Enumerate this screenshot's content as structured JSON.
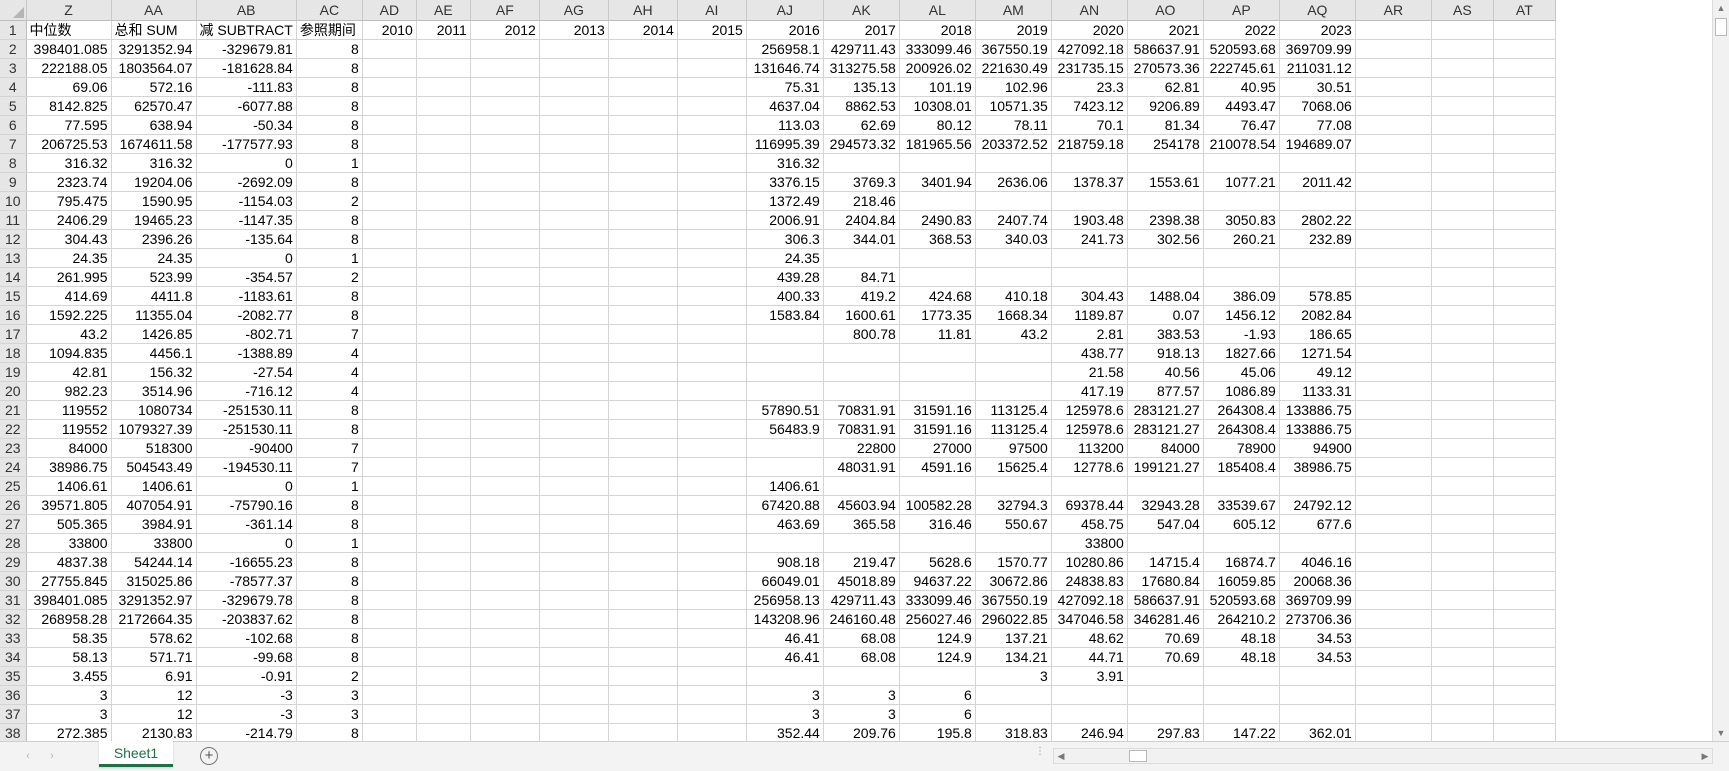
{
  "columns": [
    {
      "name": "Z",
      "header": "中位数"
    },
    {
      "name": "AA",
      "header": "总和 SUM"
    },
    {
      "name": "AB",
      "header": "减 SUBTRACT"
    },
    {
      "name": "AC",
      "header": "参照期间"
    },
    {
      "name": "AD",
      "header": "2010"
    },
    {
      "name": "AE",
      "header": "2011"
    },
    {
      "name": "AF",
      "header": "2012"
    },
    {
      "name": "AG",
      "header": "2013"
    },
    {
      "name": "AH",
      "header": "2014"
    },
    {
      "name": "AI",
      "header": "2015"
    },
    {
      "name": "AJ",
      "header": "2016"
    },
    {
      "name": "AK",
      "header": "2017"
    },
    {
      "name": "AL",
      "header": "2018"
    },
    {
      "name": "AM",
      "header": "2019"
    },
    {
      "name": "AN",
      "header": "2020"
    },
    {
      "name": "AO",
      "header": "2021"
    },
    {
      "name": "AP",
      "header": "2022"
    },
    {
      "name": "AQ",
      "header": "2023"
    },
    {
      "name": "AR",
      "header": ""
    },
    {
      "name": "AS",
      "header": ""
    },
    {
      "name": "AT",
      "header": ""
    }
  ],
  "rows": [
    {
      "n": "2",
      "z": "398401.085",
      "aa": "3291352.94",
      "ab": "-329679.81",
      "ac": "8",
      "y2016": "256958.1",
      "y2017": "429711.43",
      "y2018": "333099.46",
      "y2019": "367550.19",
      "y2020": "427092.18",
      "y2021": "586637.91",
      "y2022": "520593.68",
      "y2023": "369709.99"
    },
    {
      "n": "3",
      "z": "222188.05",
      "aa": "1803564.07",
      "ab": "-181628.84",
      "ac": "8",
      "y2016": "131646.74",
      "y2017": "313275.58",
      "y2018": "200926.02",
      "y2019": "221630.49",
      "y2020": "231735.15",
      "y2021": "270573.36",
      "y2022": "222745.61",
      "y2023": "211031.12"
    },
    {
      "n": "4",
      "z": "69.06",
      "aa": "572.16",
      "ab": "-111.83",
      "ac": "8",
      "y2016": "75.31",
      "y2017": "135.13",
      "y2018": "101.19",
      "y2019": "102.96",
      "y2020": "23.3",
      "y2021": "62.81",
      "y2022": "40.95",
      "y2023": "30.51"
    },
    {
      "n": "5",
      "z": "8142.825",
      "aa": "62570.47",
      "ab": "-6077.88",
      "ac": "8",
      "y2016": "4637.04",
      "y2017": "8862.53",
      "y2018": "10308.01",
      "y2019": "10571.35",
      "y2020": "7423.12",
      "y2021": "9206.89",
      "y2022": "4493.47",
      "y2023": "7068.06"
    },
    {
      "n": "6",
      "z": "77.595",
      "aa": "638.94",
      "ab": "-50.34",
      "ac": "8",
      "y2016": "113.03",
      "y2017": "62.69",
      "y2018": "80.12",
      "y2019": "78.11",
      "y2020": "70.1",
      "y2021": "81.34",
      "y2022": "76.47",
      "y2023": "77.08"
    },
    {
      "n": "7",
      "z": "206725.53",
      "aa": "1674611.58",
      "ab": "-177577.93",
      "ac": "8",
      "y2016": "116995.39",
      "y2017": "294573.32",
      "y2018": "181965.56",
      "y2019": "203372.52",
      "y2020": "218759.18",
      "y2021": "254178",
      "y2022": "210078.54",
      "y2023": "194689.07"
    },
    {
      "n": "8",
      "z": "316.32",
      "aa": "316.32",
      "ab": "0",
      "ac": "1",
      "y2016": "316.32",
      "y2017": "",
      "y2018": "",
      "y2019": "",
      "y2020": "",
      "y2021": "",
      "y2022": "",
      "y2023": ""
    },
    {
      "n": "9",
      "z": "2323.74",
      "aa": "19204.06",
      "ab": "-2692.09",
      "ac": "8",
      "y2016": "3376.15",
      "y2017": "3769.3",
      "y2018": "3401.94",
      "y2019": "2636.06",
      "y2020": "1378.37",
      "y2021": "1553.61",
      "y2022": "1077.21",
      "y2023": "2011.42"
    },
    {
      "n": "10",
      "z": "795.475",
      "aa": "1590.95",
      "ab": "-1154.03",
      "ac": "2",
      "y2016": "1372.49",
      "y2017": "218.46",
      "y2018": "",
      "y2019": "",
      "y2020": "",
      "y2021": "",
      "y2022": "",
      "y2023": ""
    },
    {
      "n": "11",
      "z": "2406.29",
      "aa": "19465.23",
      "ab": "-1147.35",
      "ac": "8",
      "y2016": "2006.91",
      "y2017": "2404.84",
      "y2018": "2490.83",
      "y2019": "2407.74",
      "y2020": "1903.48",
      "y2021": "2398.38",
      "y2022": "3050.83",
      "y2023": "2802.22"
    },
    {
      "n": "12",
      "z": "304.43",
      "aa": "2396.26",
      "ab": "-135.64",
      "ac": "8",
      "y2016": "306.3",
      "y2017": "344.01",
      "y2018": "368.53",
      "y2019": "340.03",
      "y2020": "241.73",
      "y2021": "302.56",
      "y2022": "260.21",
      "y2023": "232.89"
    },
    {
      "n": "13",
      "z": "24.35",
      "aa": "24.35",
      "ab": "0",
      "ac": "1",
      "y2016": "24.35",
      "y2017": "",
      "y2018": "",
      "y2019": "",
      "y2020": "",
      "y2021": "",
      "y2022": "",
      "y2023": ""
    },
    {
      "n": "14",
      "z": "261.995",
      "aa": "523.99",
      "ab": "-354.57",
      "ac": "2",
      "y2016": "439.28",
      "y2017": "84.71",
      "y2018": "",
      "y2019": "",
      "y2020": "",
      "y2021": "",
      "y2022": "",
      "y2023": ""
    },
    {
      "n": "15",
      "z": "414.69",
      "aa": "4411.8",
      "ab": "-1183.61",
      "ac": "8",
      "y2016": "400.33",
      "y2017": "419.2",
      "y2018": "424.68",
      "y2019": "410.18",
      "y2020": "304.43",
      "y2021": "1488.04",
      "y2022": "386.09",
      "y2023": "578.85"
    },
    {
      "n": "16",
      "z": "1592.225",
      "aa": "11355.04",
      "ab": "-2082.77",
      "ac": "8",
      "y2016": "1583.84",
      "y2017": "1600.61",
      "y2018": "1773.35",
      "y2019": "1668.34",
      "y2020": "1189.87",
      "y2021": "0.07",
      "y2022": "1456.12",
      "y2023": "2082.84"
    },
    {
      "n": "17",
      "z": "43.2",
      "aa": "1426.85",
      "ab": "-802.71",
      "ac": "7",
      "y2016": "",
      "y2017": "800.78",
      "y2018": "11.81",
      "y2019": "43.2",
      "y2020": "2.81",
      "y2021": "383.53",
      "y2022": "-1.93",
      "y2023": "186.65"
    },
    {
      "n": "18",
      "z": "1094.835",
      "aa": "4456.1",
      "ab": "-1388.89",
      "ac": "4",
      "y2016": "",
      "y2017": "",
      "y2018": "",
      "y2019": "",
      "y2020": "438.77",
      "y2021": "918.13",
      "y2022": "1827.66",
      "y2023": "1271.54"
    },
    {
      "n": "19",
      "z": "42.81",
      "aa": "156.32",
      "ab": "-27.54",
      "ac": "4",
      "y2016": "",
      "y2017": "",
      "y2018": "",
      "y2019": "",
      "y2020": "21.58",
      "y2021": "40.56",
      "y2022": "45.06",
      "y2023": "49.12"
    },
    {
      "n": "20",
      "z": "982.23",
      "aa": "3514.96",
      "ab": "-716.12",
      "ac": "4",
      "y2016": "",
      "y2017": "",
      "y2018": "",
      "y2019": "",
      "y2020": "417.19",
      "y2021": "877.57",
      "y2022": "1086.89",
      "y2023": "1133.31"
    },
    {
      "n": "21",
      "z": "119552",
      "aa": "1080734",
      "ab": "-251530.11",
      "ac": "8",
      "y2016": "57890.51",
      "y2017": "70831.91",
      "y2018": "31591.16",
      "y2019": "113125.4",
      "y2020": "125978.6",
      "y2021": "283121.27",
      "y2022": "264308.4",
      "y2023": "133886.75"
    },
    {
      "n": "22",
      "z": "119552",
      "aa": "1079327.39",
      "ab": "-251530.11",
      "ac": "8",
      "y2016": "56483.9",
      "y2017": "70831.91",
      "y2018": "31591.16",
      "y2019": "113125.4",
      "y2020": "125978.6",
      "y2021": "283121.27",
      "y2022": "264308.4",
      "y2023": "133886.75"
    },
    {
      "n": "23",
      "z": "84000",
      "aa": "518300",
      "ab": "-90400",
      "ac": "7",
      "y2016": "",
      "y2017": "22800",
      "y2018": "27000",
      "y2019": "97500",
      "y2020": "113200",
      "y2021": "84000",
      "y2022": "78900",
      "y2023": "94900"
    },
    {
      "n": "24",
      "z": "38986.75",
      "aa": "504543.49",
      "ab": "-194530.11",
      "ac": "7",
      "y2016": "",
      "y2017": "48031.91",
      "y2018": "4591.16",
      "y2019": "15625.4",
      "y2020": "12778.6",
      "y2021": "199121.27",
      "y2022": "185408.4",
      "y2023": "38986.75"
    },
    {
      "n": "25",
      "z": "1406.61",
      "aa": "1406.61",
      "ab": "0",
      "ac": "1",
      "y2016": "1406.61",
      "y2017": "",
      "y2018": "",
      "y2019": "",
      "y2020": "",
      "y2021": "",
      "y2022": "",
      "y2023": ""
    },
    {
      "n": "26",
      "z": "39571.805",
      "aa": "407054.91",
      "ab": "-75790.16",
      "ac": "8",
      "y2016": "67420.88",
      "y2017": "45603.94",
      "y2018": "100582.28",
      "y2019": "32794.3",
      "y2020": "69378.44",
      "y2021": "32943.28",
      "y2022": "33539.67",
      "y2023": "24792.12"
    },
    {
      "n": "27",
      "z": "505.365",
      "aa": "3984.91",
      "ab": "-361.14",
      "ac": "8",
      "y2016": "463.69",
      "y2017": "365.58",
      "y2018": "316.46",
      "y2019": "550.67",
      "y2020": "458.75",
      "y2021": "547.04",
      "y2022": "605.12",
      "y2023": "677.6"
    },
    {
      "n": "28",
      "z": "33800",
      "aa": "33800",
      "ab": "0",
      "ac": "1",
      "y2016": "",
      "y2017": "",
      "y2018": "",
      "y2019": "",
      "y2020": "33800",
      "y2021": "",
      "y2022": "",
      "y2023": ""
    },
    {
      "n": "29",
      "z": "4837.38",
      "aa": "54244.14",
      "ab": "-16655.23",
      "ac": "8",
      "y2016": "908.18",
      "y2017": "219.47",
      "y2018": "5628.6",
      "y2019": "1570.77",
      "y2020": "10280.86",
      "y2021": "14715.4",
      "y2022": "16874.7",
      "y2023": "4046.16"
    },
    {
      "n": "30",
      "z": "27755.845",
      "aa": "315025.86",
      "ab": "-78577.37",
      "ac": "8",
      "y2016": "66049.01",
      "y2017": "45018.89",
      "y2018": "94637.22",
      "y2019": "30672.86",
      "y2020": "24838.83",
      "y2021": "17680.84",
      "y2022": "16059.85",
      "y2023": "20068.36"
    },
    {
      "n": "31",
      "z": "398401.085",
      "aa": "3291352.97",
      "ab": "-329679.78",
      "ac": "8",
      "y2016": "256958.13",
      "y2017": "429711.43",
      "y2018": "333099.46",
      "y2019": "367550.19",
      "y2020": "427092.18",
      "y2021": "586637.91",
      "y2022": "520593.68",
      "y2023": "369709.99"
    },
    {
      "n": "32",
      "z": "268958.28",
      "aa": "2172664.35",
      "ab": "-203837.62",
      "ac": "8",
      "y2016": "143208.96",
      "y2017": "246160.48",
      "y2018": "256027.46",
      "y2019": "296022.85",
      "y2020": "347046.58",
      "y2021": "346281.46",
      "y2022": "264210.2",
      "y2023": "273706.36"
    },
    {
      "n": "33",
      "z": "58.35",
      "aa": "578.62",
      "ab": "-102.68",
      "ac": "8",
      "y2016": "46.41",
      "y2017": "68.08",
      "y2018": "124.9",
      "y2019": "137.21",
      "y2020": "48.62",
      "y2021": "70.69",
      "y2022": "48.18",
      "y2023": "34.53"
    },
    {
      "n": "34",
      "z": "58.13",
      "aa": "571.71",
      "ab": "-99.68",
      "ac": "8",
      "y2016": "46.41",
      "y2017": "68.08",
      "y2018": "124.9",
      "y2019": "134.21",
      "y2020": "44.71",
      "y2021": "70.69",
      "y2022": "48.18",
      "y2023": "34.53"
    },
    {
      "n": "35",
      "z": "3.455",
      "aa": "6.91",
      "ab": "-0.91",
      "ac": "2",
      "y2016": "",
      "y2017": "",
      "y2018": "",
      "y2019": "3",
      "y2020": "3.91",
      "y2021": "",
      "y2022": "",
      "y2023": ""
    },
    {
      "n": "36",
      "z": "3",
      "aa": "12",
      "ab": "-3",
      "ac": "3",
      "y2016": "3",
      "y2017": "3",
      "y2018": "6",
      "y2019": "",
      "y2020": "",
      "y2021": "",
      "y2022": "",
      "y2023": ""
    },
    {
      "n": "37",
      "z": "3",
      "aa": "12",
      "ab": "-3",
      "ac": "3",
      "y2016": "3",
      "y2017": "3",
      "y2018": "6",
      "y2019": "",
      "y2020": "",
      "y2021": "",
      "y2022": "",
      "y2023": ""
    },
    {
      "n": "38",
      "z": "272.385",
      "aa": "2130.83",
      "ab": "-214.79",
      "ac": "8",
      "y2016": "352.44",
      "y2017": "209.76",
      "y2018": "195.8",
      "y2019": "318.83",
      "y2020": "246.94",
      "y2021": "297.83",
      "y2022": "147.22",
      "y2023": "362.01"
    }
  ],
  "header_row_number": "1",
  "sheet_tab": {
    "label": "Sheet1"
  },
  "icons": {
    "prev_sheet": "chevron-left-icon",
    "next_sheet": "chevron-right-icon",
    "add_sheet": "plus-circle-icon",
    "scroll_up": "triangle-up-icon",
    "scroll_down": "triangle-down-icon",
    "scroll_left": "triangle-left-icon",
    "scroll_right": "triangle-right-icon"
  },
  "colors": {
    "accent": "#1e7145",
    "header_bg": "#e6e6e6",
    "gridline": "#d4d4d4"
  }
}
